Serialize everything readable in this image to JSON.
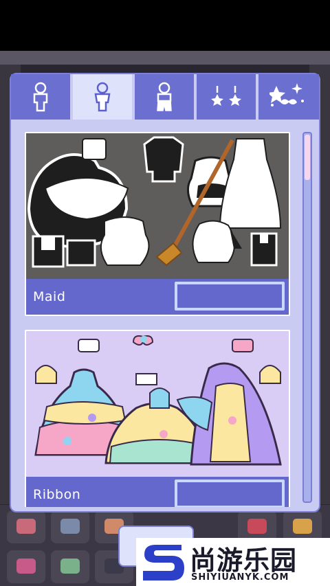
{
  "tabs": [
    {
      "id": "body",
      "icon": "body-silhouette-icon",
      "active": false
    },
    {
      "id": "outfit",
      "icon": "outfit-silhouette-icon",
      "active": true
    },
    {
      "id": "bottoms",
      "icon": "bottoms-silhouette-icon",
      "active": false
    },
    {
      "id": "earrings",
      "icon": "earrings-icon",
      "active": false
    },
    {
      "id": "accessories",
      "icon": "sparkle-bow-icon",
      "active": false
    }
  ],
  "cards": [
    {
      "label": "Maid",
      "art": "maid-outfit-set",
      "art_bg": "#5f5c5c"
    },
    {
      "label": "Ribbon",
      "art": "ribbon-pastel-dress-set",
      "art_bg": "#d9cdf6"
    }
  ],
  "watermark": {
    "cn": "尚游乐园",
    "en": "SHIYIUANYK.COM"
  },
  "colors": {
    "panel": "#c9cbf2",
    "tab": "#6b6fd0",
    "tab_active": "#dfe2fb",
    "label_bar": "#6468cc"
  }
}
